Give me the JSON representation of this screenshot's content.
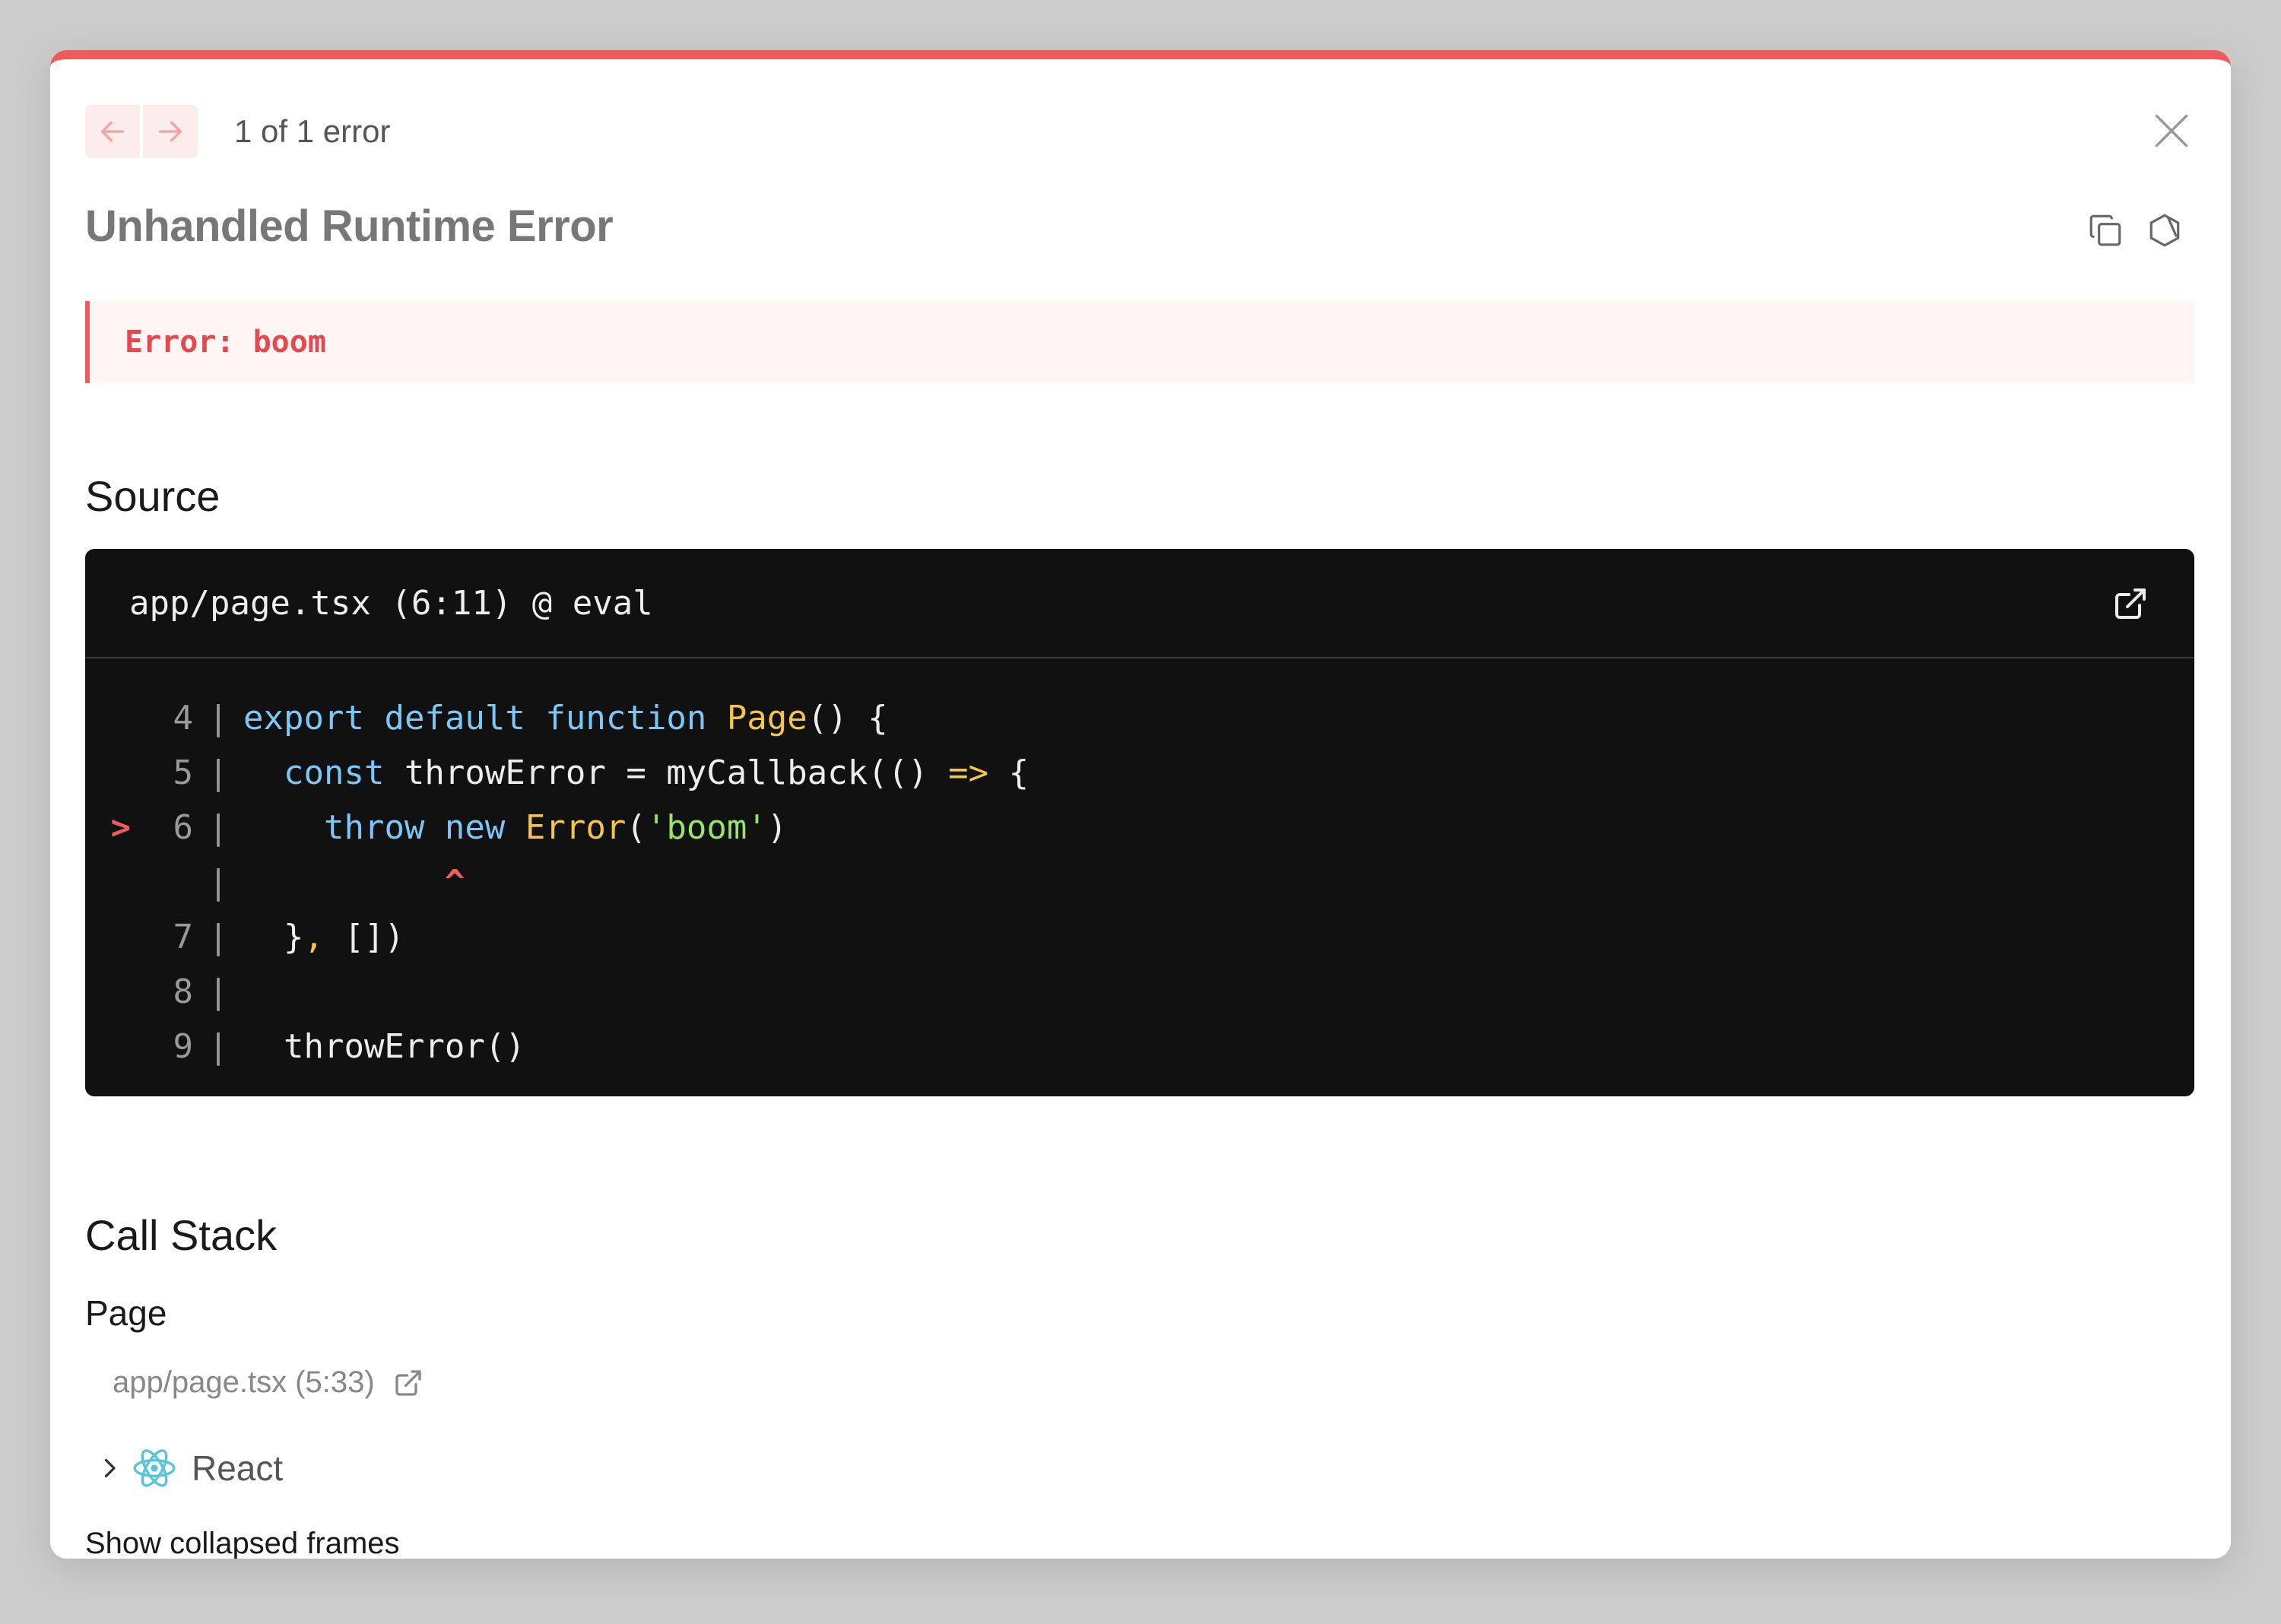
{
  "nav": {
    "prev_icon": "arrow-left-icon",
    "next_icon": "arrow-right-icon",
    "count_label": "1 of 1 error",
    "close_icon": "close-icon"
  },
  "title": "Unhandled Runtime Error",
  "toolbar": {
    "copy_icon": "copy-icon",
    "docs_icon": "hexagon-icon"
  },
  "error": {
    "message": "Error: boom"
  },
  "source": {
    "heading": "Source",
    "file_label": "app/page.tsx (6:11) @ eval",
    "open_icon": "external-link-icon",
    "lines": [
      {
        "marker": "",
        "num": "4"
      },
      {
        "marker": "",
        "num": "5"
      },
      {
        "marker": ">",
        "num": "6"
      },
      {
        "marker": "",
        "num": ""
      },
      {
        "marker": "",
        "num": "7"
      },
      {
        "marker": "",
        "num": "8"
      },
      {
        "marker": "",
        "num": "9"
      }
    ],
    "code": {
      "l4_export": "export",
      "l4_default": "default",
      "l4_function": "function",
      "l4_name": "Page",
      "l4_rest": "() {",
      "l5_const": "const",
      "l5_mid": " throwError = myCallback(() ",
      "l5_arrow": "=>",
      "l5_end": " {",
      "l6_throw": "throw",
      "l6_new": "new",
      "l6_error": "Error",
      "l6_open": "(",
      "l6_str": "'boom'",
      "l6_close": ")",
      "caret": "^",
      "l7_close": "}",
      "l7_comma": ",",
      "l7_rest": " [])",
      "l9_call": "throwError()"
    }
  },
  "call_stack": {
    "heading": "Call Stack",
    "frame_name": "Page",
    "frame_location": "app/page.tsx (5:33)",
    "react_label": "React",
    "show_collapsed": "Show collapsed frames"
  },
  "colors": {
    "accent": "#ef5b5b",
    "code_bg": "#111111",
    "keyword": "#7cc7f5",
    "function": "#f5c54a",
    "string": "#9be26b"
  }
}
